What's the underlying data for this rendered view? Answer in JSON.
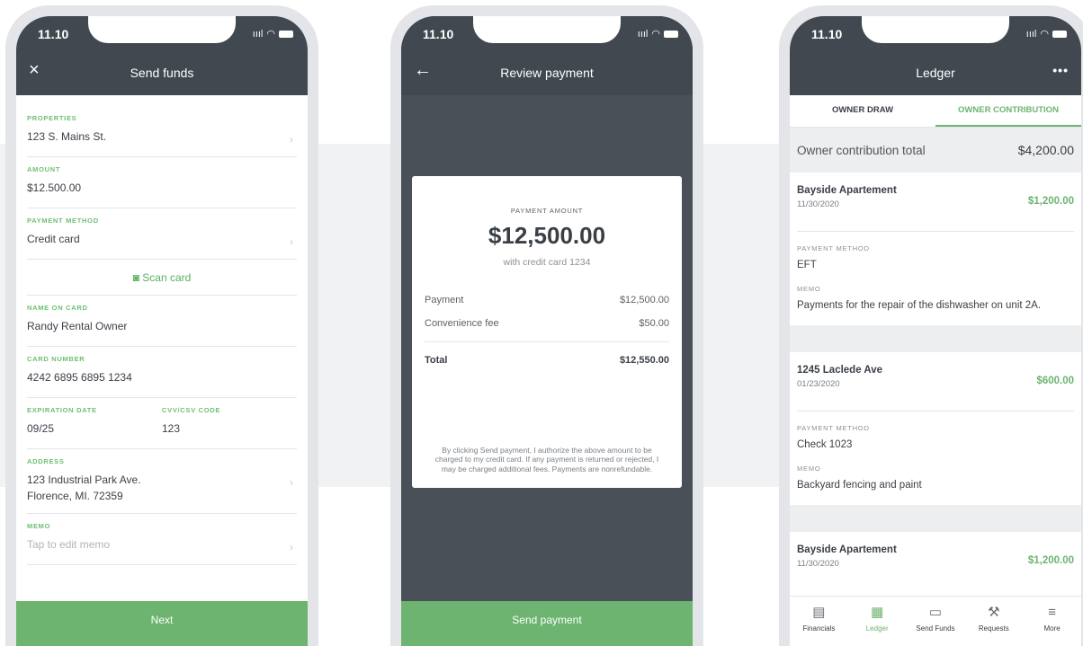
{
  "status": {
    "time": "11.10",
    "signal": "ıııl"
  },
  "send_funds": {
    "title": "Send funds",
    "close_icon": "×",
    "properties_label": "PROPERTIES",
    "properties_value": "123 S. Mains St.",
    "amount_label": "AMOUNT",
    "amount_value": "$12.500.00",
    "payment_method_label": "PAYMENT METHOD",
    "payment_method_value": "Credit card",
    "scan_card": "Scan card",
    "name_label": "NAME ON CARD",
    "name_value": "Randy Rental Owner",
    "card_number_label": "CARD NUMBER",
    "card_number_value": "4242 6895 6895 1234",
    "expiration_label": "EXPIRATION DATE",
    "expiration_value": "09/25",
    "cvv_label": "CVV/CSV CODE",
    "cvv_value": "123",
    "address_label": "ADDRESS",
    "address_line1": "123 Industrial Park Ave.",
    "address_line2": "Florence, MI. 72359",
    "memo_label": "MEMO",
    "memo_placeholder": "Tap to edit memo",
    "next": "Next"
  },
  "review": {
    "title": "Review payment",
    "back_icon": "←",
    "amount_label": "PAYMENT AMOUNT",
    "amount": "$12,500.00",
    "with_card": "with credit card 1234",
    "payment_label": "Payment",
    "payment_value": "$12,500.00",
    "fee_label": "Convenience fee",
    "fee_value": "$50.00",
    "total_label": "Total",
    "total_value": "$12,550.00",
    "disclaimer": "By clicking Send payment, I authorize the above amount to be charged to my credit card. If any payment is returned or rejected, I may be charged additional fees. Payments are nonrefundable.",
    "send": "Send payment"
  },
  "ledger": {
    "title": "Ledger",
    "more_icon": "•••",
    "tabs": [
      "OWNER DRAW",
      "OWNER CONTRIBUTION"
    ],
    "total_label": "Owner contribution total",
    "total_value": "$4,200.00",
    "entries": [
      {
        "name": "Bayside Apartement",
        "date": "11/30/2020",
        "amount": "$1,200.00",
        "method_label": "PAYMENT METHOD",
        "method": "EFT",
        "memo_label": "MEMO",
        "memo": "Payments for the repair of the dishwasher on unit 2A."
      },
      {
        "name": "1245 Laclede Ave",
        "date": "01/23/2020",
        "amount": "$600.00",
        "method_label": "PAYMENT METHOD",
        "method": "Check 1023",
        "memo_label": "MEMO",
        "memo": "Backyard fencing and paint"
      },
      {
        "name": "Bayside Apartement",
        "date": "11/30/2020",
        "amount": "$1,200.00"
      }
    ],
    "nav": [
      "Financials",
      "Ledger",
      "Send Funds",
      "Requests",
      "More"
    ]
  }
}
